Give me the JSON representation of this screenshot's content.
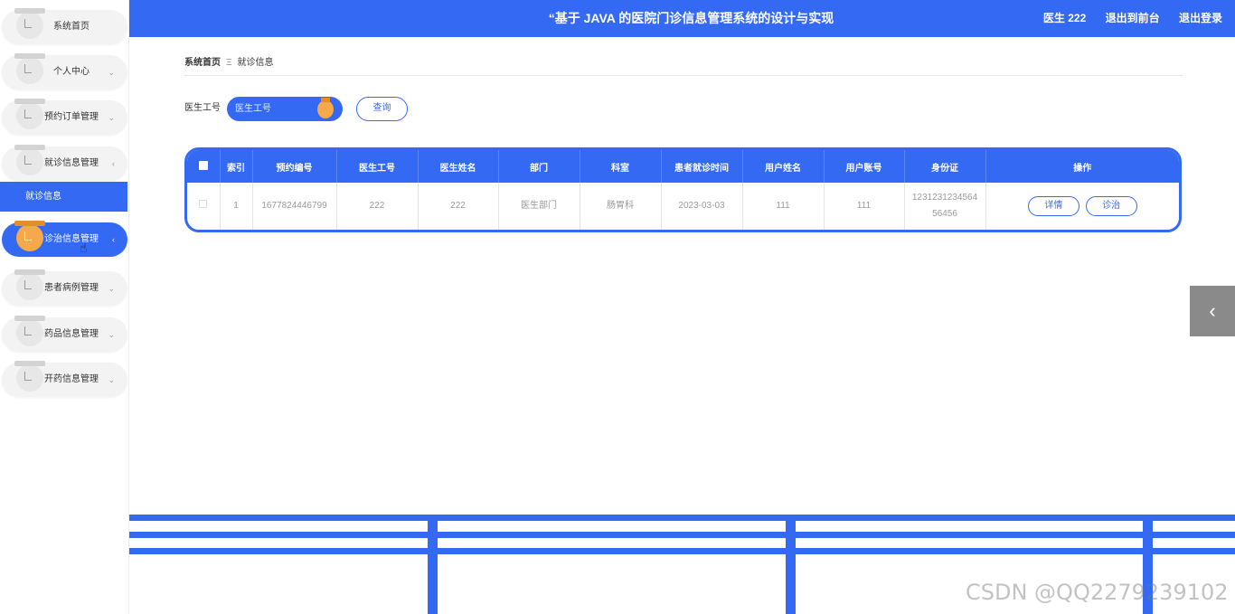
{
  "header": {
    "title": "“基于 JAVA 的医院门诊信息管理系统的设计与实现",
    "user": "医生 222",
    "exit_front": "退出到前台",
    "logout": "退出登录"
  },
  "sidebar": {
    "items": [
      {
        "label": "系统首页",
        "chevron": ""
      },
      {
        "label": "个人中心",
        "chevron": "⌄"
      },
      {
        "label": "预约订单管理",
        "chevron": "⌄"
      },
      {
        "label": "就诊信息管理",
        "chevron": "‹"
      },
      {
        "label": "诊治信息管理",
        "chevron": "‹"
      },
      {
        "label": "患者病例管理",
        "chevron": "⌄"
      },
      {
        "label": "药品信息管理",
        "chevron": "⌄"
      },
      {
        "label": "开药信息管理",
        "chevron": "⌄"
      }
    ],
    "submenu_label": "就诊信息"
  },
  "breadcrumb": {
    "home": "系统首页",
    "separator": "Ξ",
    "current": "就诊信息"
  },
  "search": {
    "label": "医生工号",
    "placeholder": "医生工号",
    "button": "查询"
  },
  "table": {
    "columns": [
      "索引",
      "预约编号",
      "医生工号",
      "医生姓名",
      "部门",
      "科室",
      "患者就诊时间",
      "用户姓名",
      "用户账号",
      "身份证",
      "操作"
    ],
    "rows": [
      {
        "index": "1",
        "booking_no": "1677824446799",
        "doctor_id": "222",
        "doctor_name": "222",
        "department": "医生部门",
        "section": "肠胃科",
        "visit_time": "2023-03-03",
        "user_name": "111",
        "user_account": "111",
        "id_card": "123123123456456456",
        "actions": [
          "详情",
          "诊治"
        ]
      }
    ]
  },
  "float_tab": {
    "icon": "chevron-left-icon",
    "glyph": "‹"
  },
  "watermark": "CSDN @QQ2279239102",
  "colors": {
    "primary": "#3469f3",
    "accent": "#f5a94a",
    "float_tab": "#8a8a8a"
  }
}
